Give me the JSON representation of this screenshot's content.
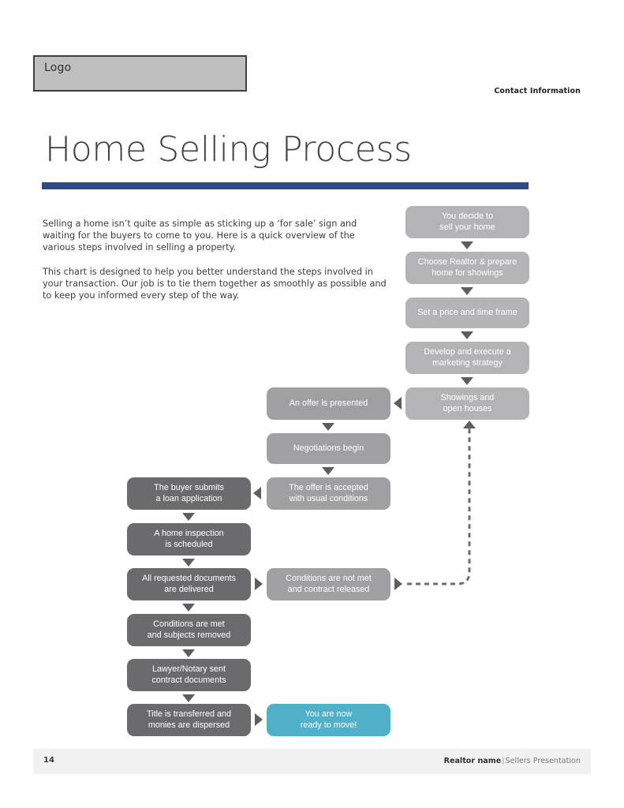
{
  "header": {
    "logo_label": "Logo",
    "contact_label": "Contact Information"
  },
  "title": "Home Selling Process",
  "accent_colors": {
    "title_rule": "#2b4b85",
    "node_light": "#b4b4b6",
    "node_mid": "#a0a0a2",
    "node_dark": "#6b6b6e",
    "node_teal": "#4fb0c8",
    "arrow": "#5e5e61",
    "logo_fill": "#bfbfbf",
    "footer_band": "#f1f1f1"
  },
  "intro": {
    "paragraph_1": "Selling a home isn’t quite as simple as sticking up a ‘for sale’ sign and waiting for the buyers to come to you. Here is a quick overview of the various steps involved in selling a property.",
    "paragraph_2": "This chart is designed to help you better understand the steps involved in your transaction. Our job is to tie them together as smoothly as possible and to keep you informed every step of the way."
  },
  "chart_data": {
    "type": "diagram",
    "title": "Home Selling Process",
    "nodes": [
      {
        "id": "n1",
        "text": "You decide to sell your home",
        "line1": "You decide to",
        "line2": "sell your home",
        "shade": "light",
        "column": "right"
      },
      {
        "id": "n2",
        "text": "Choose Realtor & prepare home for showings",
        "line1": "Choose Realtor & prepare",
        "line2": "home for showings",
        "shade": "light",
        "column": "right"
      },
      {
        "id": "n3",
        "text": "Set a price and time frame",
        "line1": "Set a price and time frame",
        "line2": "",
        "shade": "light",
        "column": "right"
      },
      {
        "id": "n4",
        "text": "Develop and execute a marketing strategy",
        "line1": "Develop and execute a",
        "line2": "marketing strategy",
        "shade": "light",
        "column": "right"
      },
      {
        "id": "n5",
        "text": "Showings and open houses",
        "line1": "Showings and",
        "line2": "open houses",
        "shade": "light",
        "column": "right"
      },
      {
        "id": "n6",
        "text": "An offer is presented",
        "line1": "An offer is presented",
        "line2": "",
        "shade": "mid",
        "column": "middle"
      },
      {
        "id": "n7",
        "text": "Negotiations begin",
        "line1": "Negotiations begin",
        "line2": "",
        "shade": "mid",
        "column": "middle"
      },
      {
        "id": "n8",
        "text": "The offer is accepted with usual conditions",
        "line1": "The offer is accepted",
        "line2": "with usual conditions",
        "shade": "mid",
        "column": "middle"
      },
      {
        "id": "n9",
        "text": "The buyer submits a loan application",
        "line1": "The buyer submits",
        "line2": "a loan application",
        "shade": "dark",
        "column": "left"
      },
      {
        "id": "n10",
        "text": "A home inspection is scheduled",
        "line1": "A home inspection",
        "line2": "is scheduled",
        "shade": "dark",
        "column": "left"
      },
      {
        "id": "n11",
        "text": "All requested documents are delivered",
        "line1": "All requested documents",
        "line2": "are delivered",
        "shade": "dark",
        "column": "left"
      },
      {
        "id": "n12",
        "text": "Conditions are not met and contract released",
        "line1": "Conditions are not met",
        "line2": "and contract released",
        "shade": "mid",
        "column": "middle"
      },
      {
        "id": "n13",
        "text": "Conditions are met and subjects removed",
        "line1": "Conditions are met",
        "line2": "and subjects removed",
        "shade": "dark",
        "column": "left"
      },
      {
        "id": "n14",
        "text": "Lawyer/Notary sent contract documents",
        "line1": "Lawyer/Notary sent",
        "line2": "contract documents",
        "shade": "dark",
        "column": "left"
      },
      {
        "id": "n15",
        "text": "Title is transferred and monies are dispersed",
        "line1": "Title is transferred and",
        "line2": "monies are dispersed",
        "shade": "dark",
        "column": "left"
      },
      {
        "id": "n16",
        "text": "You are now ready to move!",
        "line1": "You are now",
        "line2": "ready to move!",
        "shade": "teal",
        "column": "middle"
      }
    ],
    "edges": [
      {
        "from": "n1",
        "to": "n2",
        "style": "solid",
        "direction": "down"
      },
      {
        "from": "n2",
        "to": "n3",
        "style": "solid",
        "direction": "down"
      },
      {
        "from": "n3",
        "to": "n4",
        "style": "solid",
        "direction": "down"
      },
      {
        "from": "n4",
        "to": "n5",
        "style": "solid",
        "direction": "down"
      },
      {
        "from": "n5",
        "to": "n6",
        "style": "solid",
        "direction": "left"
      },
      {
        "from": "n6",
        "to": "n7",
        "style": "solid",
        "direction": "down"
      },
      {
        "from": "n7",
        "to": "n8",
        "style": "solid",
        "direction": "down"
      },
      {
        "from": "n8",
        "to": "n9",
        "style": "solid",
        "direction": "left"
      },
      {
        "from": "n9",
        "to": "n10",
        "style": "solid",
        "direction": "down"
      },
      {
        "from": "n10",
        "to": "n11",
        "style": "solid",
        "direction": "down"
      },
      {
        "from": "n11",
        "to": "n12",
        "style": "solid",
        "direction": "right"
      },
      {
        "from": "n11",
        "to": "n13",
        "style": "solid",
        "direction": "down"
      },
      {
        "from": "n12",
        "to": "n5",
        "style": "dashed",
        "direction": "up"
      },
      {
        "from": "n13",
        "to": "n14",
        "style": "solid",
        "direction": "down"
      },
      {
        "from": "n14",
        "to": "n15",
        "style": "solid",
        "direction": "down"
      },
      {
        "from": "n15",
        "to": "n16",
        "style": "solid",
        "direction": "right"
      }
    ]
  },
  "footer": {
    "page_number": "14",
    "realtor_name": "Realtor name",
    "separator": "|",
    "presentation": "Sellers Presentation"
  }
}
